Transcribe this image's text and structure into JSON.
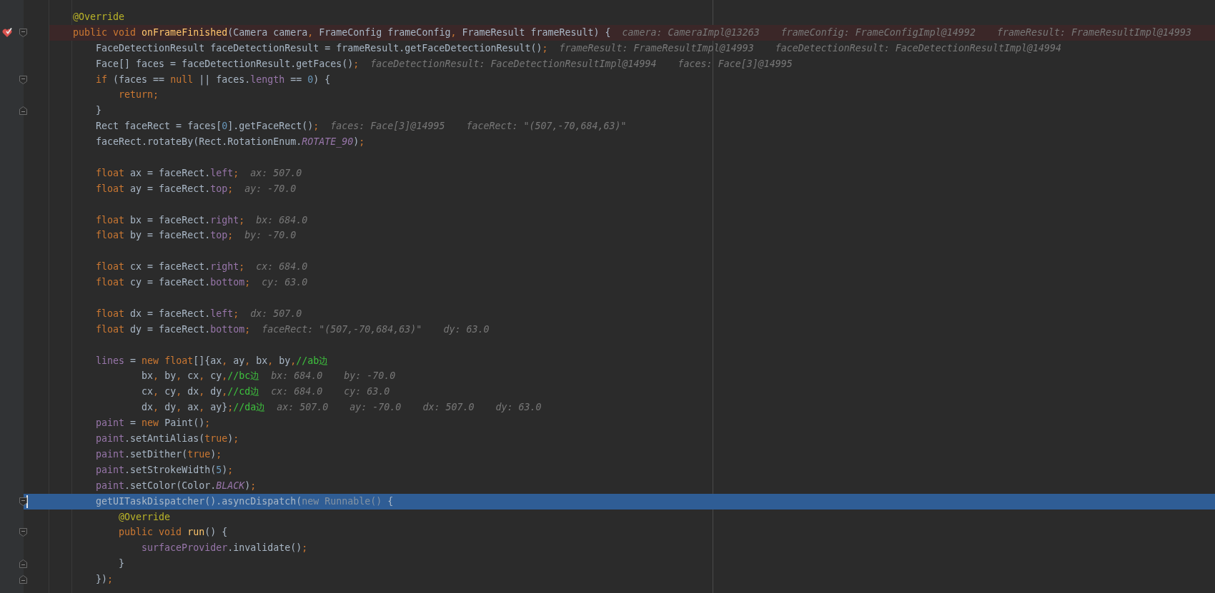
{
  "editor": {
    "lines": [
      {
        "kind": "plain",
        "tokens": [
          {
            "kind": "ann",
            "text": "    @Override"
          }
        ],
        "breakpoint": false,
        "current": false
      },
      {
        "kind": "open",
        "tokens": [
          {
            "kind": "kw",
            "text": "    public void "
          },
          {
            "kind": "decl",
            "text": "onFrameFinished"
          },
          {
            "kind": "plain",
            "text": "(Camera camera"
          },
          {
            "kind": "kw",
            "text": ", "
          },
          {
            "kind": "plain",
            "text": "FrameConfig frameConfig"
          },
          {
            "kind": "kw",
            "text": ", "
          },
          {
            "kind": "plain",
            "text": "FrameResult frameResult) {"
          }
        ],
        "hints": [
          "camera: CameraImpl@13263",
          "frameConfig: FrameConfigImpl@14992",
          "frameResult: FrameResultImpl@14993"
        ],
        "breakpoint": true,
        "current": false
      },
      {
        "kind": "plain",
        "tokens": [
          {
            "kind": "plain",
            "text": "        FaceDetectionResult faceDetectionResult = frameResult.getFaceDetectionResult()"
          },
          {
            "kind": "kw",
            "text": ";"
          }
        ],
        "hints": [
          "frameResult: FrameResultImpl@14993",
          "faceDetectionResult: FaceDetectionResultImpl@14994"
        ],
        "breakpoint": false,
        "current": false
      },
      {
        "kind": "plain",
        "tokens": [
          {
            "kind": "plain",
            "text": "        Face[] faces = faceDetectionResult.getFaces()"
          },
          {
            "kind": "kw",
            "text": ";"
          }
        ],
        "hints": [
          "faceDetectionResult: FaceDetectionResultImpl@14994",
          "faces: Face[3]@14995"
        ],
        "breakpoint": false,
        "current": false
      },
      {
        "kind": "open",
        "tokens": [
          {
            "kind": "kw",
            "text": "        if "
          },
          {
            "kind": "plain",
            "text": "(faces == "
          },
          {
            "kind": "kw",
            "text": "null"
          },
          {
            "kind": "plain",
            "text": " || faces."
          },
          {
            "kind": "field",
            "text": "length"
          },
          {
            "kind": "plain",
            "text": " == "
          },
          {
            "kind": "num",
            "text": "0"
          },
          {
            "kind": "plain",
            "text": ") {"
          }
        ],
        "breakpoint": false,
        "current": false
      },
      {
        "kind": "plain",
        "tokens": [
          {
            "kind": "kw",
            "text": "            return;"
          }
        ],
        "breakpoint": false,
        "current": false
      },
      {
        "kind": "close",
        "tokens": [
          {
            "kind": "plain",
            "text": "        }"
          }
        ],
        "breakpoint": false,
        "current": false
      },
      {
        "kind": "plain",
        "tokens": [
          {
            "kind": "plain",
            "text": "        Rect faceRect = faces["
          },
          {
            "kind": "num",
            "text": "0"
          },
          {
            "kind": "plain",
            "text": "].getFaceRect()"
          },
          {
            "kind": "kw",
            "text": ";"
          }
        ],
        "hints": [
          "faces: Face[3]@14995",
          "faceRect: \"(507,-70,684,63)\""
        ],
        "breakpoint": false,
        "current": false
      },
      {
        "kind": "plain",
        "tokens": [
          {
            "kind": "plain",
            "text": "        faceRect.rotateBy(Rect.RotationEnum."
          },
          {
            "kind": "const",
            "text": "ROTATE_90"
          },
          {
            "kind": "plain",
            "text": ")"
          },
          {
            "kind": "kw",
            "text": ";"
          }
        ],
        "breakpoint": false,
        "current": false
      },
      {
        "kind": "plain",
        "breakpoint": false,
        "current": false
      },
      {
        "kind": "plain",
        "tokens": [
          {
            "kind": "kw",
            "text": "        float "
          },
          {
            "kind": "plain",
            "text": "ax = faceRect."
          },
          {
            "kind": "field",
            "text": "left"
          },
          {
            "kind": "kw",
            "text": ";"
          }
        ],
        "hints": [
          "ax: 507.0"
        ],
        "breakpoint": false,
        "current": false
      },
      {
        "kind": "plain",
        "tokens": [
          {
            "kind": "kw",
            "text": "        float "
          },
          {
            "kind": "plain",
            "text": "ay = faceRect."
          },
          {
            "kind": "field",
            "text": "top"
          },
          {
            "kind": "kw",
            "text": ";"
          }
        ],
        "hints": [
          "ay: -70.0"
        ],
        "breakpoint": false,
        "current": false
      },
      {
        "kind": "plain",
        "breakpoint": false,
        "current": false
      },
      {
        "kind": "plain",
        "tokens": [
          {
            "kind": "kw",
            "text": "        float "
          },
          {
            "kind": "plain",
            "text": "bx = faceRect."
          },
          {
            "kind": "field",
            "text": "right"
          },
          {
            "kind": "kw",
            "text": ";"
          }
        ],
        "hints": [
          "bx: 684.0"
        ],
        "breakpoint": false,
        "current": false
      },
      {
        "kind": "plain",
        "tokens": [
          {
            "kind": "kw",
            "text": "        float "
          },
          {
            "kind": "plain",
            "text": "by = faceRect."
          },
          {
            "kind": "field",
            "text": "top"
          },
          {
            "kind": "kw",
            "text": ";"
          }
        ],
        "hints": [
          "by: -70.0"
        ],
        "breakpoint": false,
        "current": false
      },
      {
        "kind": "plain",
        "breakpoint": false,
        "current": false
      },
      {
        "kind": "plain",
        "tokens": [
          {
            "kind": "kw",
            "text": "        float "
          },
          {
            "kind": "plain",
            "text": "cx = faceRect."
          },
          {
            "kind": "field",
            "text": "right"
          },
          {
            "kind": "kw",
            "text": ";"
          }
        ],
        "hints": [
          "cx: 684.0"
        ],
        "breakpoint": false,
        "current": false
      },
      {
        "kind": "plain",
        "tokens": [
          {
            "kind": "kw",
            "text": "        float "
          },
          {
            "kind": "plain",
            "text": "cy = faceRect."
          },
          {
            "kind": "field",
            "text": "bottom"
          },
          {
            "kind": "kw",
            "text": ";"
          }
        ],
        "hints": [
          "cy: 63.0"
        ],
        "breakpoint": false,
        "current": false
      },
      {
        "kind": "plain",
        "breakpoint": false,
        "current": false
      },
      {
        "kind": "plain",
        "tokens": [
          {
            "kind": "kw",
            "text": "        float "
          },
          {
            "kind": "plain",
            "text": "dx = faceRect."
          },
          {
            "kind": "field",
            "text": "left"
          },
          {
            "kind": "kw",
            "text": ";"
          }
        ],
        "hints": [
          "dx: 507.0"
        ],
        "breakpoint": false,
        "current": false
      },
      {
        "kind": "plain",
        "tokens": [
          {
            "kind": "kw",
            "text": "        float "
          },
          {
            "kind": "plain",
            "text": "dy = faceRect."
          },
          {
            "kind": "field",
            "text": "bottom"
          },
          {
            "kind": "kw",
            "text": ";"
          }
        ],
        "hints": [
          "faceRect: \"(507,-70,684,63)\"",
          "dy: 63.0"
        ],
        "breakpoint": false,
        "current": false
      },
      {
        "kind": "plain",
        "breakpoint": false,
        "current": false
      },
      {
        "kind": "plain",
        "tokens": [
          {
            "kind": "field",
            "text": "        lines"
          },
          {
            "kind": "plain",
            "text": " = "
          },
          {
            "kind": "kw",
            "text": "new float"
          },
          {
            "kind": "plain",
            "text": "[]{ax"
          },
          {
            "kind": "kw",
            "text": ", "
          },
          {
            "kind": "plain",
            "text": "ay"
          },
          {
            "kind": "kw",
            "text": ", "
          },
          {
            "kind": "plain",
            "text": "bx"
          },
          {
            "kind": "kw",
            "text": ", "
          },
          {
            "kind": "plain",
            "text": "by"
          },
          {
            "kind": "kw",
            "text": ","
          },
          {
            "kind": "comment",
            "text": "//ab边"
          }
        ],
        "breakpoint": false,
        "current": false
      },
      {
        "kind": "plain",
        "tokens": [
          {
            "kind": "plain",
            "text": "                bx"
          },
          {
            "kind": "kw",
            "text": ", "
          },
          {
            "kind": "plain",
            "text": "by"
          },
          {
            "kind": "kw",
            "text": ", "
          },
          {
            "kind": "plain",
            "text": "cx"
          },
          {
            "kind": "kw",
            "text": ", "
          },
          {
            "kind": "plain",
            "text": "cy"
          },
          {
            "kind": "kw",
            "text": ","
          },
          {
            "kind": "comment",
            "text": "//bc边"
          }
        ],
        "hints": [
          "bx: 684.0",
          "by: -70.0"
        ],
        "breakpoint": false,
        "current": false
      },
      {
        "kind": "plain",
        "tokens": [
          {
            "kind": "plain",
            "text": "                cx"
          },
          {
            "kind": "kw",
            "text": ", "
          },
          {
            "kind": "plain",
            "text": "cy"
          },
          {
            "kind": "kw",
            "text": ", "
          },
          {
            "kind": "plain",
            "text": "dx"
          },
          {
            "kind": "kw",
            "text": ", "
          },
          {
            "kind": "plain",
            "text": "dy"
          },
          {
            "kind": "kw",
            "text": ","
          },
          {
            "kind": "comment",
            "text": "//cd边"
          }
        ],
        "hints": [
          "cx: 684.0",
          "cy: 63.0"
        ],
        "breakpoint": false,
        "current": false
      },
      {
        "kind": "plain",
        "tokens": [
          {
            "kind": "plain",
            "text": "                dx"
          },
          {
            "kind": "kw",
            "text": ", "
          },
          {
            "kind": "plain",
            "text": "dy"
          },
          {
            "kind": "kw",
            "text": ", "
          },
          {
            "kind": "plain",
            "text": "ax"
          },
          {
            "kind": "kw",
            "text": ", "
          },
          {
            "kind": "plain",
            "text": "ay}"
          },
          {
            "kind": "kw",
            "text": ";"
          },
          {
            "kind": "comment",
            "text": "//da边"
          }
        ],
        "hints": [
          "ax: 507.0",
          "ay: -70.0",
          "dx: 507.0",
          "dy: 63.0"
        ],
        "breakpoint": false,
        "current": false
      },
      {
        "kind": "plain",
        "tokens": [
          {
            "kind": "field",
            "text": "        paint"
          },
          {
            "kind": "plain",
            "text": " = "
          },
          {
            "kind": "kw",
            "text": "new "
          },
          {
            "kind": "plain",
            "text": "Paint()"
          },
          {
            "kind": "kw",
            "text": ";"
          }
        ],
        "breakpoint": false,
        "current": false
      },
      {
        "kind": "plain",
        "tokens": [
          {
            "kind": "field",
            "text": "        paint"
          },
          {
            "kind": "plain",
            "text": ".setAntiAlias("
          },
          {
            "kind": "kw",
            "text": "true"
          },
          {
            "kind": "plain",
            "text": ")"
          },
          {
            "kind": "kw",
            "text": ";"
          }
        ],
        "breakpoint": false,
        "current": false
      },
      {
        "kind": "plain",
        "tokens": [
          {
            "kind": "field",
            "text": "        paint"
          },
          {
            "kind": "plain",
            "text": ".setDither("
          },
          {
            "kind": "kw",
            "text": "true"
          },
          {
            "kind": "plain",
            "text": ")"
          },
          {
            "kind": "kw",
            "text": ";"
          }
        ],
        "breakpoint": false,
        "current": false
      },
      {
        "kind": "plain",
        "tokens": [
          {
            "kind": "field",
            "text": "        paint"
          },
          {
            "kind": "plain",
            "text": ".setStrokeWidth("
          },
          {
            "kind": "num",
            "text": "5"
          },
          {
            "kind": "plain",
            "text": ")"
          },
          {
            "kind": "kw",
            "text": ";"
          }
        ],
        "breakpoint": false,
        "current": false
      },
      {
        "kind": "plain",
        "tokens": [
          {
            "kind": "field",
            "text": "        paint"
          },
          {
            "kind": "plain",
            "text": ".setColor(Color."
          },
          {
            "kind": "const",
            "text": "BLACK"
          },
          {
            "kind": "plain",
            "text": ")"
          },
          {
            "kind": "kw",
            "text": ";"
          }
        ],
        "breakpoint": false,
        "current": false
      },
      {
        "kind": "open",
        "tokens": [
          {
            "kind": "plain",
            "text": "        getUITaskDispatcher().asyncDispatch("
          },
          {
            "kind": "unused",
            "text": "new Runnable()"
          },
          {
            "kind": "plain",
            "text": " {"
          }
        ],
        "breakpoint": false,
        "current": true
      },
      {
        "kind": "plain",
        "tokens": [
          {
            "kind": "ann",
            "text": "            @Override"
          }
        ],
        "breakpoint": false,
        "current": false
      },
      {
        "kind": "open",
        "tokens": [
          {
            "kind": "kw",
            "text": "            public void "
          },
          {
            "kind": "decl",
            "text": "run"
          },
          {
            "kind": "plain",
            "text": "() {"
          }
        ],
        "breakpoint": false,
        "current": false
      },
      {
        "kind": "plain",
        "tokens": [
          {
            "kind": "field",
            "text": "                surfaceProvider"
          },
          {
            "kind": "plain",
            "text": ".invalidate()"
          },
          {
            "kind": "kw",
            "text": ";"
          }
        ],
        "breakpoint": false,
        "current": false
      },
      {
        "kind": "close",
        "tokens": [
          {
            "kind": "plain",
            "text": "            }"
          }
        ],
        "breakpoint": false,
        "current": false
      },
      {
        "kind": "close",
        "tokens": [
          {
            "kind": "plain",
            "text": "        })"
          },
          {
            "kind": "kw",
            "text": ";"
          }
        ],
        "breakpoint": false,
        "current": false
      }
    ]
  }
}
